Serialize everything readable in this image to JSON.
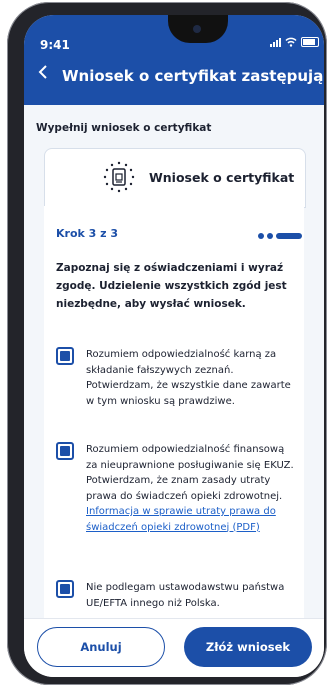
{
  "status": {
    "time": "9:41"
  },
  "header": {
    "back_icon": "chevron-left-icon",
    "title": "Wniosek o certyfikat zastępujący"
  },
  "form": {
    "subtitle": "Wypełnij wniosek o certyfikat",
    "card_title": "Wniosek o certyfikat",
    "card_icon": "eu-document-icon",
    "step_label": "Krok 3 z 3",
    "intro": "Zapoznaj się z oświadczeniami i wyraź zgodę. Udzielenie wszystkich zgód jest niezbędne, aby wysłać wniosek.",
    "consents": [
      {
        "checked": true,
        "text": "Rozumiem odpowiedzialność karną za składanie fałszywych zeznań. Potwierdzam, że wszystkie dane zawarte w tym wniosku są prawdziwe."
      },
      {
        "checked": true,
        "text": "Rozumiem odpowiedzialność finansową za nieuprawnione posługiwanie się EKUZ. Potwierdzam, że znam zasady utraty prawa do świadczeń opieki zdrowotnej.",
        "link": "Informacja w sprawie utraty prawa do świadczeń opieki zdrowotnej (PDF)"
      },
      {
        "checked": true,
        "text": "Nie podlegam ustawodawstwu państwa UE/EFTA innego niż Polska."
      }
    ]
  },
  "footer": {
    "cancel_label": "Anuluj",
    "submit_label": "Złóż wniosek"
  },
  "colors": {
    "primary": "#1c4fa8",
    "link": "#1c5fc8"
  }
}
